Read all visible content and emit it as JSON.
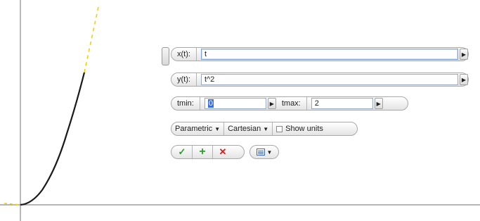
{
  "graph": {
    "curve_color": "#1a1a1a",
    "extension_color": "#f0d000",
    "axis_color": "#8a8a8a"
  },
  "x_row": {
    "label": "x(t):",
    "value": "t"
  },
  "y_row": {
    "label": "y(t):",
    "value": "t^2"
  },
  "range": {
    "tmin_label": "tmin:",
    "tmin_value": "0",
    "tmax_label": "tmax:",
    "tmax_value": "2"
  },
  "options": {
    "mode": "Parametric",
    "coords": "Cartesian",
    "show_units_label": "Show units",
    "show_units_checked": false
  },
  "actions": {
    "ok_glyph": "✓",
    "add_glyph": "+",
    "cancel_glyph": "✕"
  },
  "icons": {
    "arrow": "▶",
    "caret": "▼"
  }
}
